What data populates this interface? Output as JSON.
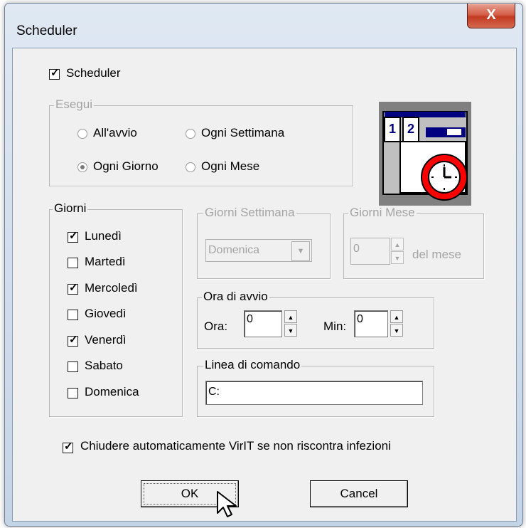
{
  "window": {
    "title": "Scheduler",
    "close_glyph": "X"
  },
  "scheduler_checkbox": {
    "label": "Scheduler",
    "checked": true
  },
  "esegui": {
    "title": "Esegui",
    "options": [
      {
        "label": "All'avvio",
        "selected": false
      },
      {
        "label": "Ogni Settimana",
        "selected": false
      },
      {
        "label": "Ogni Giorno",
        "selected": true
      },
      {
        "label": "Ogni Mese",
        "selected": false
      }
    ]
  },
  "giorni": {
    "title": "Giorni",
    "days": [
      {
        "label": "Lunedì",
        "checked": true
      },
      {
        "label": "Martedì",
        "checked": false
      },
      {
        "label": "Mercoledì",
        "checked": true
      },
      {
        "label": "Giovedì",
        "checked": false
      },
      {
        "label": "Venerdì",
        "checked": true
      },
      {
        "label": "Sabato",
        "checked": false
      },
      {
        "label": "Domenica",
        "checked": false
      }
    ]
  },
  "giorni_settimana": {
    "title": "Giorni Settimana",
    "selected": "Domenica"
  },
  "giorni_mese": {
    "title": "Giorni Mese",
    "value": "0",
    "suffix": "del mese"
  },
  "ora_avvio": {
    "title": "Ora di avvio",
    "ora_label": "Ora:",
    "ora_value": "0",
    "min_label": "Min:",
    "min_value": "0"
  },
  "linea_comando": {
    "title": "Linea di comando",
    "value": "C:"
  },
  "auto_close": {
    "label": "Chiudere automaticamente VirIT se non riscontra infezioni",
    "checked": true
  },
  "buttons": {
    "ok": "OK",
    "cancel": "Cancel"
  },
  "calendar_icon": {
    "day1": "1",
    "day2": "2"
  }
}
